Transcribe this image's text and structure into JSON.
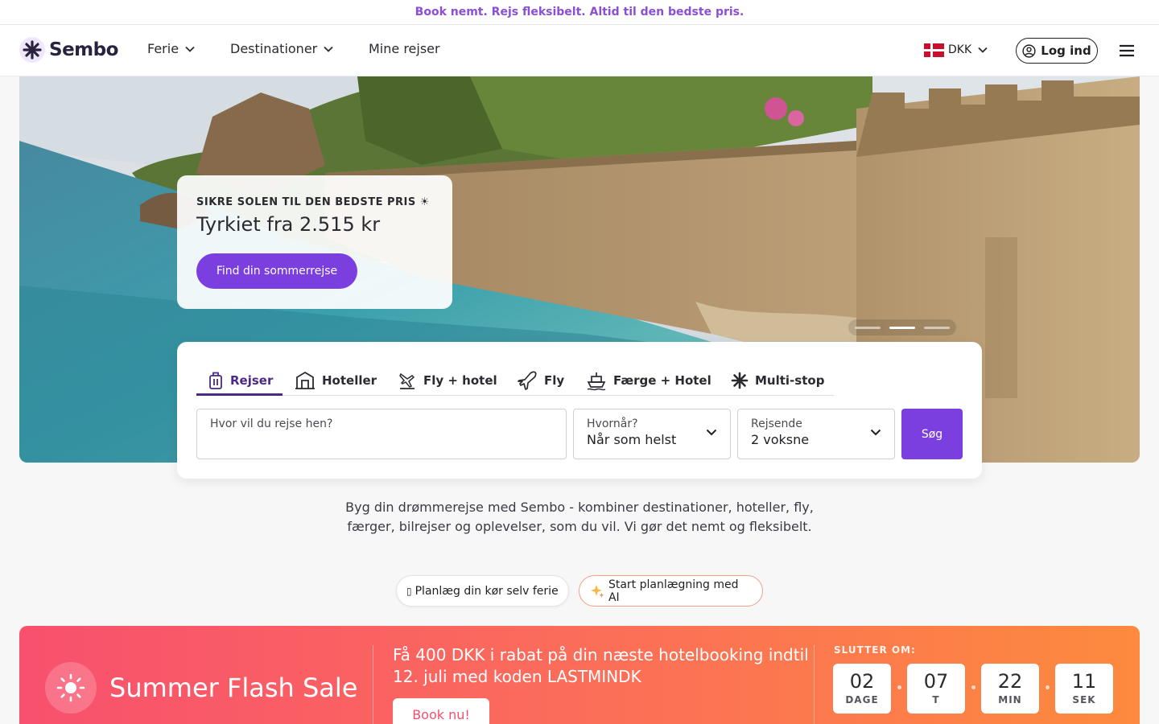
{
  "announcement": "Book nemt. Rejs fleksibelt. Altid til den bedste pris.",
  "nav": {
    "brand": "Sembo",
    "links": [
      "Ferie",
      "Destinationer",
      "Mine rejser"
    ],
    "currency": "DKK",
    "login": "Log ind"
  },
  "hero": {
    "kicker": "SIKRE SOLEN TIL DEN BEDSTE PRIS ☀",
    "headline": "Tyrkiet fra 2.515 kr",
    "cta": "Find din sommerrejse",
    "slides_total": 3,
    "slides_active": 2
  },
  "search": {
    "tabs": [
      "Rejser",
      "Hoteller",
      "Fly + hotel",
      "Fly",
      "Færge + Hotel",
      "Multi-stop"
    ],
    "active_tab": "Rejser",
    "destination": {
      "label": "Hvor vil du rejse hen?",
      "value": ""
    },
    "when": {
      "label": "Hvornår?",
      "value": "Når som helst"
    },
    "travellers": {
      "label": "Rejsende",
      "value": "2 voksne"
    },
    "submit": "Søg"
  },
  "intro": "Byg din drømmerejse med Sembo - kombiner destinationer, hoteller, fly, færger, bilrejser og oplevelser, som du vil. Vi gør det nemt og fleksibelt.",
  "pills": [
    "Planlæg din kør selv ferie",
    "Start planlægning med AI"
  ],
  "sale": {
    "title": "Summer Flash Sale",
    "text": "Få 400 DKK i rabat på din næste hotelbooking indtil 12. juli med koden LASTMINDK",
    "button": "Book nu!",
    "ends_label": "SLUTTER OM:",
    "countdown": [
      {
        "value": "02",
        "unit": "DAGE"
      },
      {
        "value": "07",
        "unit": "T"
      },
      {
        "value": "22",
        "unit": "MIN"
      },
      {
        "value": "11",
        "unit": "SEK"
      }
    ]
  },
  "colors": {
    "accent": "#7b3fe0",
    "brand_dark": "#4a2a85",
    "announcement": "#8a4fd6",
    "sale_start": "#f8506e",
    "sale_end": "#fd8a3e"
  }
}
